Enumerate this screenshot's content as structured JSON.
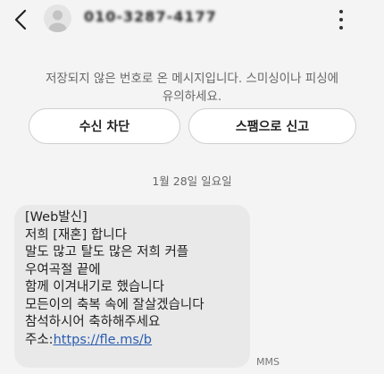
{
  "header": {
    "contact_name": "010-3287-4177",
    "back_icon": "chevron-left-icon",
    "avatar_icon": "person-silhouette-icon",
    "menu_icon": "more-vertical-icon"
  },
  "notice": {
    "line1": "저장되지 않은 번호로 온 메시지입니다. 스미싱이나 피싱에",
    "line2": "유의하세요."
  },
  "actions": {
    "block_label": "수신 차단",
    "spam_label": "스팸으로 신고"
  },
  "date_separator": "1월 28일 일요일",
  "message": {
    "lines": [
      "[Web발신]",
      "저희 [재혼] 합니다",
      "말도 많고 탈도 많은 저희 커플",
      "우여곡절 끝에",
      "함께 이겨내기로 했습니다",
      "모든이의 축복 속에 잘살겠습니다",
      "참석하시어 축하해주세요"
    ],
    "link_prefix": "주소:",
    "link_text": "https://fle.ms/b",
    "type_label": "MMS"
  },
  "colors": {
    "background": "#f4f4f4",
    "bubble": "#e9e9e9",
    "link": "#2a5db0",
    "notice_text": "#666666"
  }
}
